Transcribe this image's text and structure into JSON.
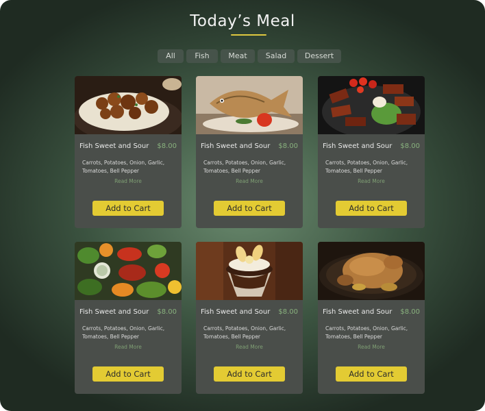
{
  "page": {
    "title": "Today’s Meal"
  },
  "filters": [
    "All",
    "Fish",
    "Meat",
    "Salad",
    "Dessert"
  ],
  "cards": [
    {
      "image": "braised-pork-rice",
      "name": "Fish Sweet and Sour",
      "price": "$8.00",
      "description": "Carrots, Potatoes, Onion, Garlic, Tomatoes, Bell Pepper",
      "read_more": "Read More",
      "button": "Add to Cart"
    },
    {
      "image": "fish-dish",
      "name": "Fish Sweet and Sour",
      "price": "$8.00",
      "description": "Carrots, Potatoes, Onion, Garlic, Tomatoes, Bell Pepper",
      "read_more": "Read More",
      "button": "Add to Cart"
    },
    {
      "image": "pork-belly-bowl",
      "name": "Fish Sweet and Sour",
      "price": "$8.00",
      "description": "Carrots, Potatoes, Onion, Garlic, Tomatoes, Bell Pepper",
      "read_more": "Read More",
      "button": "Add to Cart"
    },
    {
      "image": "salad",
      "name": "Fish Sweet and Sour",
      "price": "$8.00",
      "description": "Carrots, Potatoes, Onion, Garlic, Tomatoes, Bell Pepper",
      "read_more": "Read More",
      "button": "Add to Cart"
    },
    {
      "image": "banana-sundae",
      "name": "Fish Sweet and Sour",
      "price": "$8.00",
      "description": "Carrots, Potatoes, Onion, Garlic, Tomatoes, Bell Pepper",
      "read_more": "Read More",
      "button": "Add to Cart"
    },
    {
      "image": "roast-chicken",
      "name": "Fish Sweet and Sour",
      "price": "$8.00",
      "description": "Carrots, Potatoes, Onion, Garlic, Tomatoes, Bell Pepper",
      "read_more": "Read More",
      "button": "Add to Cart"
    }
  ],
  "colors": {
    "accent": "#e3cb33",
    "price": "#89b27e",
    "card": "#4a4e4a",
    "pill": "#46534a"
  }
}
